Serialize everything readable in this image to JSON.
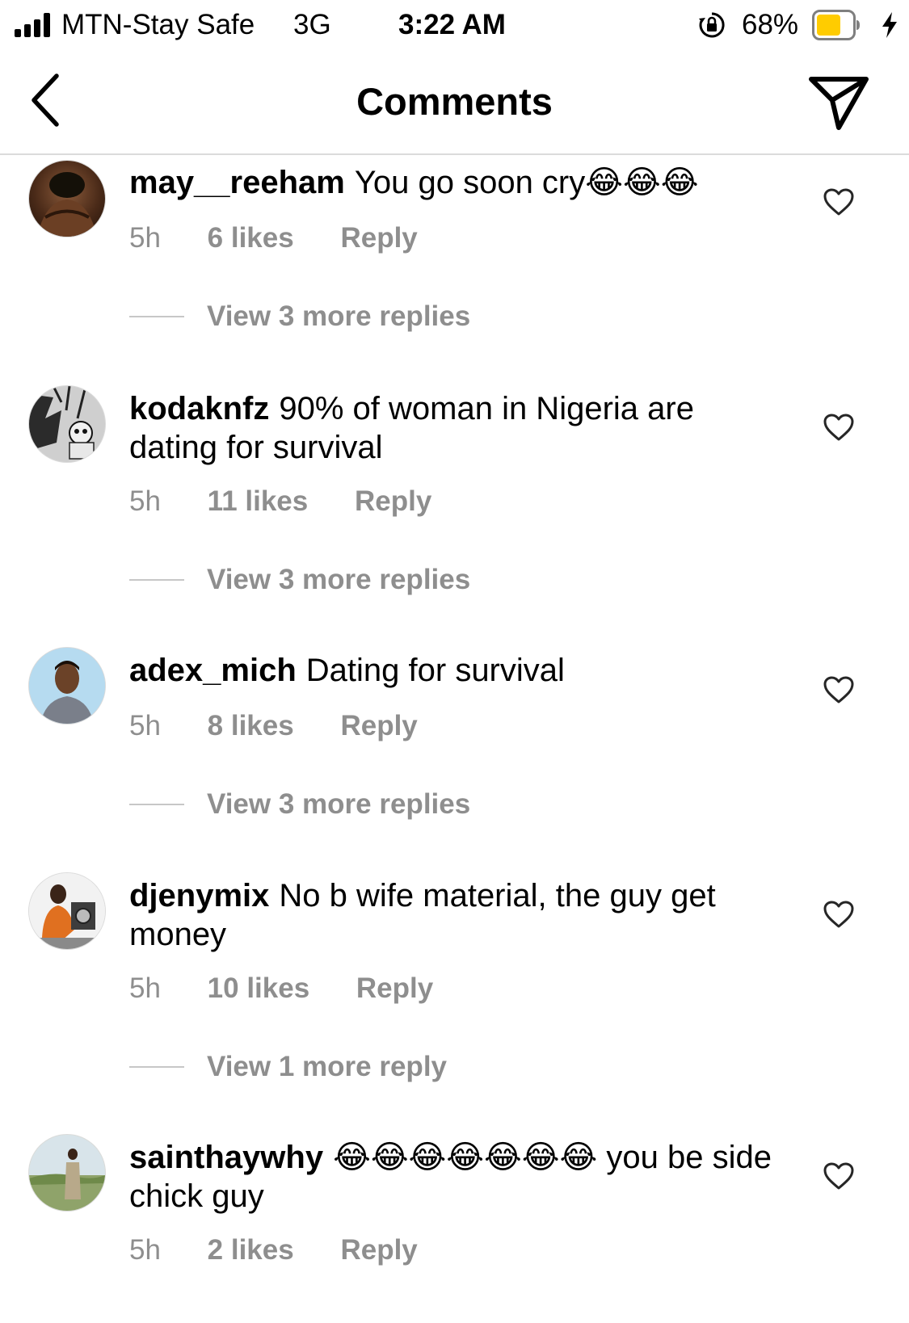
{
  "status_bar": {
    "carrier": "MTN-Stay Safe",
    "network": "3G",
    "time": "3:22 AM",
    "battery_percent": "68%",
    "battery_level": 0.68,
    "battery_color": "#ffcc00"
  },
  "header": {
    "title": "Comments",
    "back_icon": "chevron-left-icon",
    "share_icon": "paper-plane-icon"
  },
  "comments": [
    {
      "username": "may__reeham",
      "text": "You go soon cry😂😂😂",
      "time": "5h",
      "likes": "6 likes",
      "reply": "Reply",
      "view_replies": "View 3 more replies"
    },
    {
      "username": "kodaknfz",
      "text": "90% of woman in Nigeria are dating for survival",
      "time": "5h",
      "likes": "11 likes",
      "reply": "Reply",
      "view_replies": "View 3 more replies"
    },
    {
      "username": "adex_mich",
      "text": "Dating for survival",
      "time": "5h",
      "likes": "8 likes",
      "reply": "Reply",
      "view_replies": "View 3 more replies"
    },
    {
      "username": "djenymix",
      "text": "No b wife material, the guy get money",
      "time": "5h",
      "likes": "10 likes",
      "reply": "Reply",
      "view_replies": "View 1 more reply"
    },
    {
      "username": "sainthaywhy",
      "text": "😂😂😂😂😂😂😂 you be side chick guy",
      "time": "5h",
      "likes": "2 likes",
      "reply": "Reply"
    }
  ],
  "colors": {
    "meta_gray": "#8e8e8e",
    "divider": "#dbdbdb"
  }
}
